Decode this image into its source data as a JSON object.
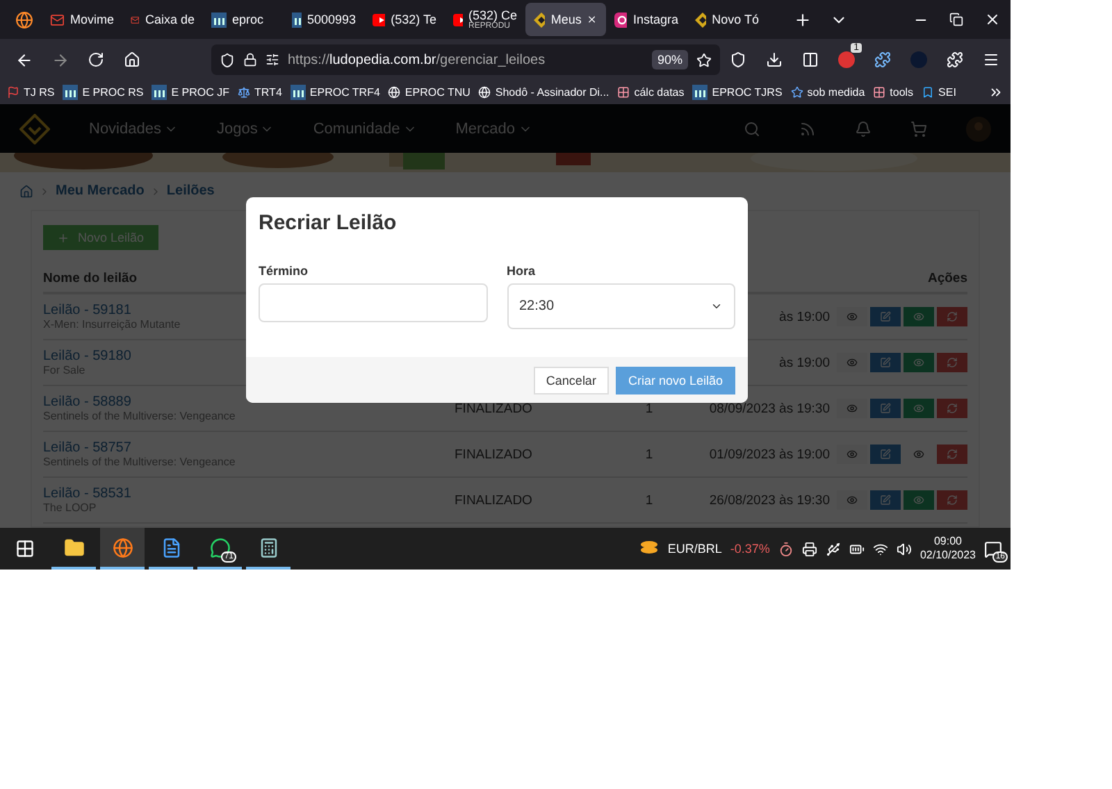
{
  "browser": {
    "tabs": [
      {
        "kind": "mail",
        "title": "Movime",
        "selected": false
      },
      {
        "kind": "mail",
        "title": "Caixa de",
        "selected": false
      },
      {
        "kind": "court",
        "title": "eproc",
        "selected": false
      },
      {
        "kind": "court",
        "title": "5000993",
        "selected": false
      },
      {
        "kind": "video",
        "title": "(532) Te",
        "selected": false
      },
      {
        "kind": "video",
        "title": "(532) Ce",
        "subtitle": "REPRODU",
        "selected": false
      },
      {
        "kind": "diamond",
        "title": "Meus",
        "selected": true
      },
      {
        "kind": "camera",
        "title": "Instagra",
        "selected": false
      },
      {
        "kind": "diamond",
        "title": "Novo Tó",
        "selected": false
      }
    ],
    "url": {
      "scheme": "https://",
      "host": "ludopedia.com.br",
      "path": "/gerenciar_leiloes"
    },
    "zoom": "90%",
    "extension_badge": "1",
    "bookmarks": [
      {
        "kind": "flag",
        "label": "TJ RS"
      },
      {
        "kind": "court",
        "label": "E PROC RS"
      },
      {
        "kind": "court",
        "label": "E PROC JF"
      },
      {
        "kind": "scale",
        "label": "TRT4"
      },
      {
        "kind": "court",
        "label": "EPROC TRF4"
      },
      {
        "kind": "globe",
        "label": "EPROC TNU"
      },
      {
        "kind": "globe",
        "label": "Shodô - Assinador Di..."
      },
      {
        "kind": "grid",
        "label": "cálc datas"
      },
      {
        "kind": "court",
        "label": "EPROC TJRS"
      },
      {
        "kind": "star",
        "label": "sob medida"
      },
      {
        "kind": "grid",
        "label": "tools"
      },
      {
        "kind": "sei",
        "label": "SEI"
      }
    ]
  },
  "site": {
    "nav": [
      "Novidades",
      "Jogos",
      "Comunidade",
      "Mercado"
    ],
    "breadcrumb": [
      "Meu Mercado",
      "Leilões"
    ],
    "new_button": "Novo Leilão",
    "table": {
      "columns": [
        "Nome do leilão",
        "Ações"
      ],
      "rows": [
        {
          "name": "Leilão - 59181",
          "subtitle": "X-Men: Insurreição Mutante",
          "date": "às 19:00",
          "watch_active": true
        },
        {
          "name": "Leilão - 59180",
          "subtitle": "For Sale",
          "date": "às 19:00",
          "watch_active": true
        },
        {
          "name": "Leilão - 58889",
          "subtitle": "Sentinels of the Multiverse: Vengeance",
          "status": "FINALIZADO",
          "quantity": "1",
          "date": "08/09/2023 às 19:30",
          "watch_active": true
        },
        {
          "name": "Leilão - 58757",
          "subtitle": "Sentinels of the Multiverse: Vengeance",
          "status": "FINALIZADO",
          "quantity": "1",
          "date": "01/09/2023 às 19:00",
          "watch_active": false
        },
        {
          "name": "Leilão - 58531",
          "subtitle": "The LOOP",
          "status": "FINALIZADO",
          "quantity": "1",
          "date": "26/08/2023 às 19:30",
          "watch_active": true
        }
      ]
    }
  },
  "modal": {
    "title": "Recriar Leilão",
    "fields": [
      {
        "label": "Término",
        "kind": "input"
      },
      {
        "label": "Hora",
        "kind": "select",
        "value": "22:30"
      }
    ],
    "buttons": [
      {
        "label": "Cancelar",
        "kind": "secondary"
      },
      {
        "label": "Criar novo Leilão",
        "kind": "primary"
      }
    ]
  },
  "taskbar": {
    "apps": [
      {
        "kind": "folder",
        "selected": false
      },
      {
        "kind": "browser",
        "selected": true
      },
      {
        "kind": "document",
        "selected": false
      },
      {
        "kind": "chat",
        "selected": false,
        "badge": "71"
      },
      {
        "kind": "calculator",
        "selected": false
      }
    ],
    "ticker": {
      "symbol": "EUR/BRL",
      "change": "-0.37%"
    },
    "time": "09:00",
    "date": "02/10/2023",
    "notifications": "16"
  }
}
